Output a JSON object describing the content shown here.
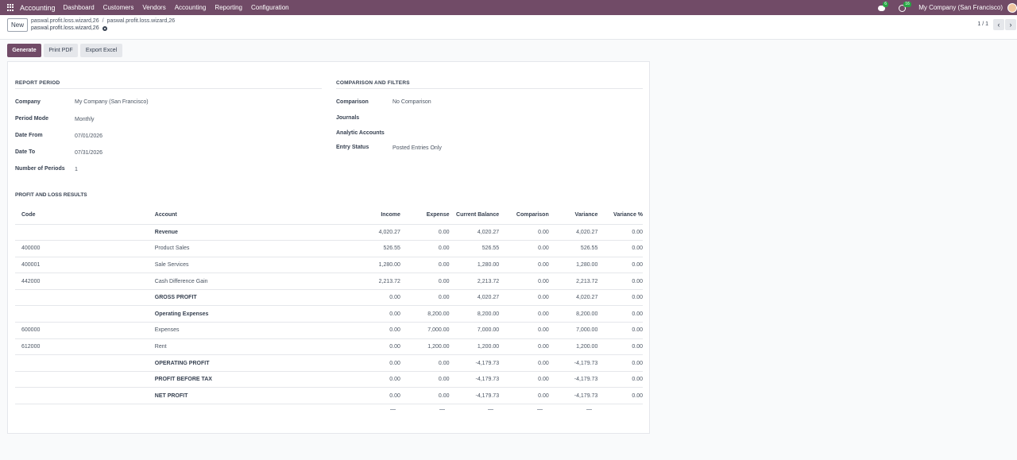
{
  "navbar": {
    "brand": "Accounting",
    "menu": [
      "Dashboard",
      "Customers",
      "Vendors",
      "Accounting",
      "Reporting",
      "Configuration"
    ],
    "messages_count": "6",
    "activities_count": "16",
    "company": "My Company (San Francisco)"
  },
  "control": {
    "new_label": "New",
    "breadcrumbs": [
      "paswal.profit.loss.wizard,26",
      "paswal.profit.loss.wizard,26"
    ],
    "record_name": "paswal.profit.loss.wizard,26",
    "pager": "1 / 1",
    "prev_icon": "‹",
    "next_icon": "›"
  },
  "actions": {
    "generate": "Generate",
    "print_pdf": "Print PDF",
    "export_excel": "Export Excel"
  },
  "report_period": {
    "title": "REPORT PERIOD",
    "fields": [
      {
        "label": "Company",
        "value": "My Company (San Francisco)"
      },
      {
        "label": "Period Mode",
        "value": "Monthly"
      },
      {
        "label": "Date From",
        "value": "07/01/2026"
      },
      {
        "label": "Date To",
        "value": "07/31/2026"
      },
      {
        "label": "Number of Periods",
        "value": "1"
      }
    ]
  },
  "comparison": {
    "title": "COMPARISON AND FILTERS",
    "fields": [
      {
        "label": "Comparison",
        "value": "No Comparison"
      },
      {
        "label": "Journals",
        "value": ""
      },
      {
        "label": "Analytic Accounts",
        "value": ""
      },
      {
        "label": "Entry Status",
        "value": "Posted Entries Only"
      }
    ]
  },
  "results": {
    "title": "PROFIT AND LOSS RESULTS",
    "columns": [
      "Code",
      "Account",
      "Income",
      "Expense",
      "Current Balance",
      "Comparison",
      "Variance",
      "Variance %"
    ],
    "rows": [
      {
        "code": "",
        "account": "Revenue",
        "income": "4,020.27",
        "expense": "0.00",
        "balance": "4,020.27",
        "comparison": "0.00",
        "variance": "4,020.27",
        "variance_pct": "0.00",
        "bold": true
      },
      {
        "code": "400000",
        "account": "Product Sales",
        "income": "526.55",
        "expense": "0.00",
        "balance": "526.55",
        "comparison": "0.00",
        "variance": "526.55",
        "variance_pct": "0.00",
        "bold": false
      },
      {
        "code": "400001",
        "account": "Sale Services",
        "income": "1,280.00",
        "expense": "0.00",
        "balance": "1,280.00",
        "comparison": "0.00",
        "variance": "1,280.00",
        "variance_pct": "0.00",
        "bold": false
      },
      {
        "code": "442000",
        "account": "Cash Difference Gain",
        "income": "2,213.72",
        "expense": "0.00",
        "balance": "2,213.72",
        "comparison": "0.00",
        "variance": "2,213.72",
        "variance_pct": "0.00",
        "bold": false
      },
      {
        "code": "",
        "account": "GROSS PROFIT",
        "income": "0.00",
        "expense": "0.00",
        "balance": "4,020.27",
        "comparison": "0.00",
        "variance": "4,020.27",
        "variance_pct": "0.00",
        "bold": true
      },
      {
        "code": "",
        "account": "Operating Expenses",
        "income": "0.00",
        "expense": "8,200.00",
        "balance": "8,200.00",
        "comparison": "0.00",
        "variance": "8,200.00",
        "variance_pct": "0.00",
        "bold": true
      },
      {
        "code": "600000",
        "account": "Expenses",
        "income": "0.00",
        "expense": "7,000.00",
        "balance": "7,000.00",
        "comparison": "0.00",
        "variance": "7,000.00",
        "variance_pct": "0.00",
        "bold": false
      },
      {
        "code": "612000",
        "account": "Rent",
        "income": "0.00",
        "expense": "1,200.00",
        "balance": "1,200.00",
        "comparison": "0.00",
        "variance": "1,200.00",
        "variance_pct": "0.00",
        "bold": false
      },
      {
        "code": "",
        "account": "OPERATING PROFIT",
        "income": "0.00",
        "expense": "0.00",
        "balance": "-4,179.73",
        "comparison": "0.00",
        "variance": "-4,179.73",
        "variance_pct": "0.00",
        "bold": true
      },
      {
        "code": "",
        "account": "PROFIT BEFORE TAX",
        "income": "0.00",
        "expense": "0.00",
        "balance": "-4,179.73",
        "comparison": "0.00",
        "variance": "-4,179.73",
        "variance_pct": "0.00",
        "bold": true
      },
      {
        "code": "",
        "account": "NET PROFIT",
        "income": "0.00",
        "expense": "0.00",
        "balance": "-4,179.73",
        "comparison": "0.00",
        "variance": "-4,179.73",
        "variance_pct": "0.00",
        "bold": true
      }
    ]
  }
}
